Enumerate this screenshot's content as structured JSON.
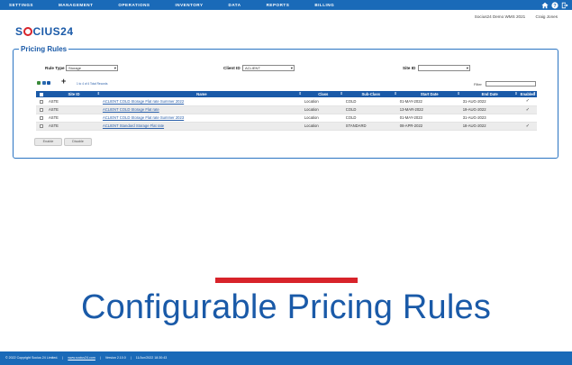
{
  "topnav": {
    "items": [
      "SETTINGS",
      "MANAGEMENT",
      "OPERATIONS",
      "INVENTORY",
      "DATA",
      "REPORTS",
      "BILLING"
    ],
    "icons": [
      "home-icon",
      "help-icon",
      "logout-icon"
    ]
  },
  "user": {
    "environment": "Socius24 Demo WMS 2021",
    "name": "Craig Jones"
  },
  "logo": {
    "pre": "S",
    "post": "CIUS24"
  },
  "page": {
    "title": "Pricing Rules"
  },
  "filters": {
    "rule_type_label": "Rule Type",
    "rule_type_value": "Storage",
    "client_id_label": "Client ID",
    "client_id_value": "ACLIENT",
    "site_id_label": "Site ID",
    "site_id_value": "",
    "filter_label": "Filter"
  },
  "records": {
    "count_text": "1 to 4 of 4 Total Records"
  },
  "table": {
    "headers": [
      "Site ID",
      "Name",
      "Class",
      "Sub-Class",
      "Start Date",
      "End Date",
      "Enabled"
    ],
    "rows": [
      {
        "site": "ASTE",
        "name": "ACLIENT COLD Storage Flat rate Summer 2022",
        "class": "Location",
        "subclass": "COLD",
        "start": "01-MAY-2022",
        "end": "31-AUG-2022",
        "enabled": "✓"
      },
      {
        "site": "ASTE",
        "name": "ACLIENT COLD Storage Flat rate",
        "class": "Location",
        "subclass": "COLD",
        "start": "13-MAR-2022",
        "end": "19-AUG-2022",
        "enabled": "✓"
      },
      {
        "site": "ASTE",
        "name": "ACLIENT COLD Storage Flat rate Summer 2023",
        "class": "Location",
        "subclass": "COLD",
        "start": "01-MAY-2023",
        "end": "31-AUG-2023",
        "enabled": ""
      },
      {
        "site": "ASTE",
        "name": "ACLIENT Standard Storage Flat rate",
        "class": "Location",
        "subclass": "STANDARD",
        "start": "08-APR-2022",
        "end": "18-AUG-2022",
        "enabled": "✓"
      }
    ]
  },
  "buttons": {
    "enable": "Enable",
    "disable": "Disable"
  },
  "headline": "Configurable Pricing Rules",
  "footer": {
    "copyright": "© 2022 Copyright Socius 24 Limited.",
    "website": "www.socius24.com",
    "version": "Version 2.10.0",
    "timestamp": "11/Jun/2022 18:30:43"
  },
  "colors": {
    "brand_blue": "#1a6ab8",
    "accent_red": "#d8232a"
  }
}
